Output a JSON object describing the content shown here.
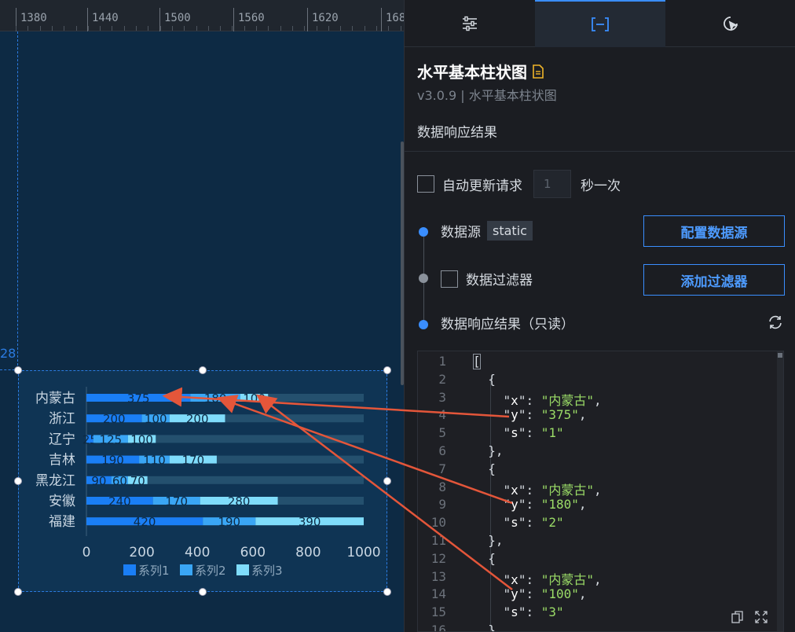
{
  "ruler": {
    "labels": [
      "1380",
      "1440",
      "1500",
      "1560",
      "1620",
      "168"
    ],
    "guide_number": "28"
  },
  "chart_data": {
    "type": "bar",
    "orientation": "horizontal",
    "stacked": true,
    "categories": [
      "内蒙古",
      "浙江",
      "辽宁",
      "吉林",
      "黑龙江",
      "安徽",
      "福建"
    ],
    "series": [
      {
        "name": "系列1",
        "values": [
          375,
          200,
          25,
          190,
          90,
          240,
          420
        ],
        "color": "#1a7ef5"
      },
      {
        "name": "系列2",
        "values": [
          180,
          100,
          125,
          110,
          60,
          170,
          190
        ],
        "color": "#3aa6f5"
      },
      {
        "name": "系列3",
        "values": [
          100,
          200,
          100,
          170,
          70,
          280,
          390
        ],
        "color": "#7fdcfb"
      }
    ],
    "xlim": [
      0,
      1000
    ],
    "xticks": [
      "0",
      "200",
      "400",
      "600",
      "800",
      "1000"
    ],
    "legend": "bottom-center",
    "track_color": "#24506e"
  },
  "panel": {
    "tabs": [
      {
        "icon": "sliders-icon"
      },
      {
        "icon": "bracket-icon"
      },
      {
        "icon": "interaction-icon"
      }
    ],
    "title": "水平基本柱状图",
    "subtitle": "v3.0.9 | 水平基本柱状图",
    "section": "数据响应结果",
    "auto_update": {
      "label": "自动更新请求",
      "interval": "1",
      "unit": "秒一次",
      "checked": false
    },
    "datasource": {
      "label": "数据源",
      "tag": "static",
      "button": "配置数据源"
    },
    "filter": {
      "label": "数据过滤器",
      "button": "添加过滤器"
    },
    "result": {
      "label": "数据响应结果（只读）"
    },
    "colors": {
      "accent": "#3a8eff",
      "string": "#9bdc67",
      "arrow": "#e4563a"
    }
  },
  "code": {
    "lines": [
      {
        "n": "1",
        "text": "["
      },
      {
        "n": "2",
        "text": "  {"
      },
      {
        "n": "3",
        "key": "x",
        "value": "内蒙古",
        "comma": true
      },
      {
        "n": "4",
        "key": "y",
        "value": "375",
        "comma": true
      },
      {
        "n": "5",
        "key": "s",
        "value": "1",
        "comma": false
      },
      {
        "n": "6",
        "text": "  },"
      },
      {
        "n": "7",
        "text": "  {"
      },
      {
        "n": "8",
        "key": "x",
        "value": "内蒙古",
        "comma": true
      },
      {
        "n": "9",
        "key": "y",
        "value": "180",
        "comma": true
      },
      {
        "n": "10",
        "key": "s",
        "value": "2",
        "comma": false
      },
      {
        "n": "11",
        "text": "  },"
      },
      {
        "n": "12",
        "text": "  {"
      },
      {
        "n": "13",
        "key": "x",
        "value": "内蒙古",
        "comma": true
      },
      {
        "n": "14",
        "key": "y",
        "value": "100",
        "comma": true
      },
      {
        "n": "15",
        "key": "s",
        "value": "3",
        "comma": false
      },
      {
        "n": "16",
        "text": "  },"
      }
    ]
  }
}
